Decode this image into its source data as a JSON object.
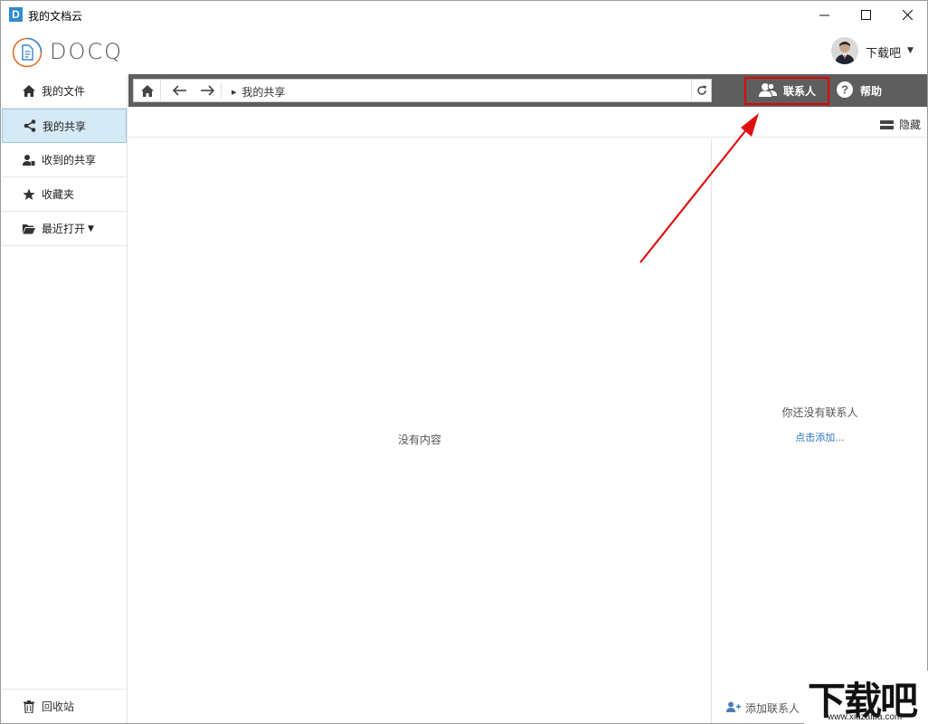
{
  "window": {
    "app_icon_letter": "D",
    "title": "我的文档云"
  },
  "header": {
    "logo_text": "DOCQ",
    "user_name": "下载吧"
  },
  "sidebar": {
    "items": [
      {
        "label": "我的文件",
        "icon": "home-icon"
      },
      {
        "label": "我的共享",
        "icon": "share-icon"
      },
      {
        "label": "收到的共享",
        "icon": "received-share-icon"
      },
      {
        "label": "收藏夹",
        "icon": "star-icon"
      },
      {
        "label": "最近打开",
        "icon": "folder-open-icon"
      }
    ],
    "active_index": 1,
    "recycle_label": "回收站"
  },
  "toolbar": {
    "path": "我的共享",
    "contacts_label": "联系人",
    "help_label": "帮助"
  },
  "subbar": {
    "hide_label": "隐藏"
  },
  "content": {
    "empty_text": "没有内容"
  },
  "contacts": {
    "empty_text": "你还没有联系人",
    "add_link": "点击添加...",
    "add_button": "添加联系人"
  },
  "watermark": {
    "text": "下载吧",
    "url": "www.xiazaiba.com"
  },
  "colors": {
    "toolbar_bg": "#5e5e5e",
    "active_item_bg": "#d6e9f6",
    "highlight_border": "#e00000",
    "link": "#2a76c0"
  }
}
